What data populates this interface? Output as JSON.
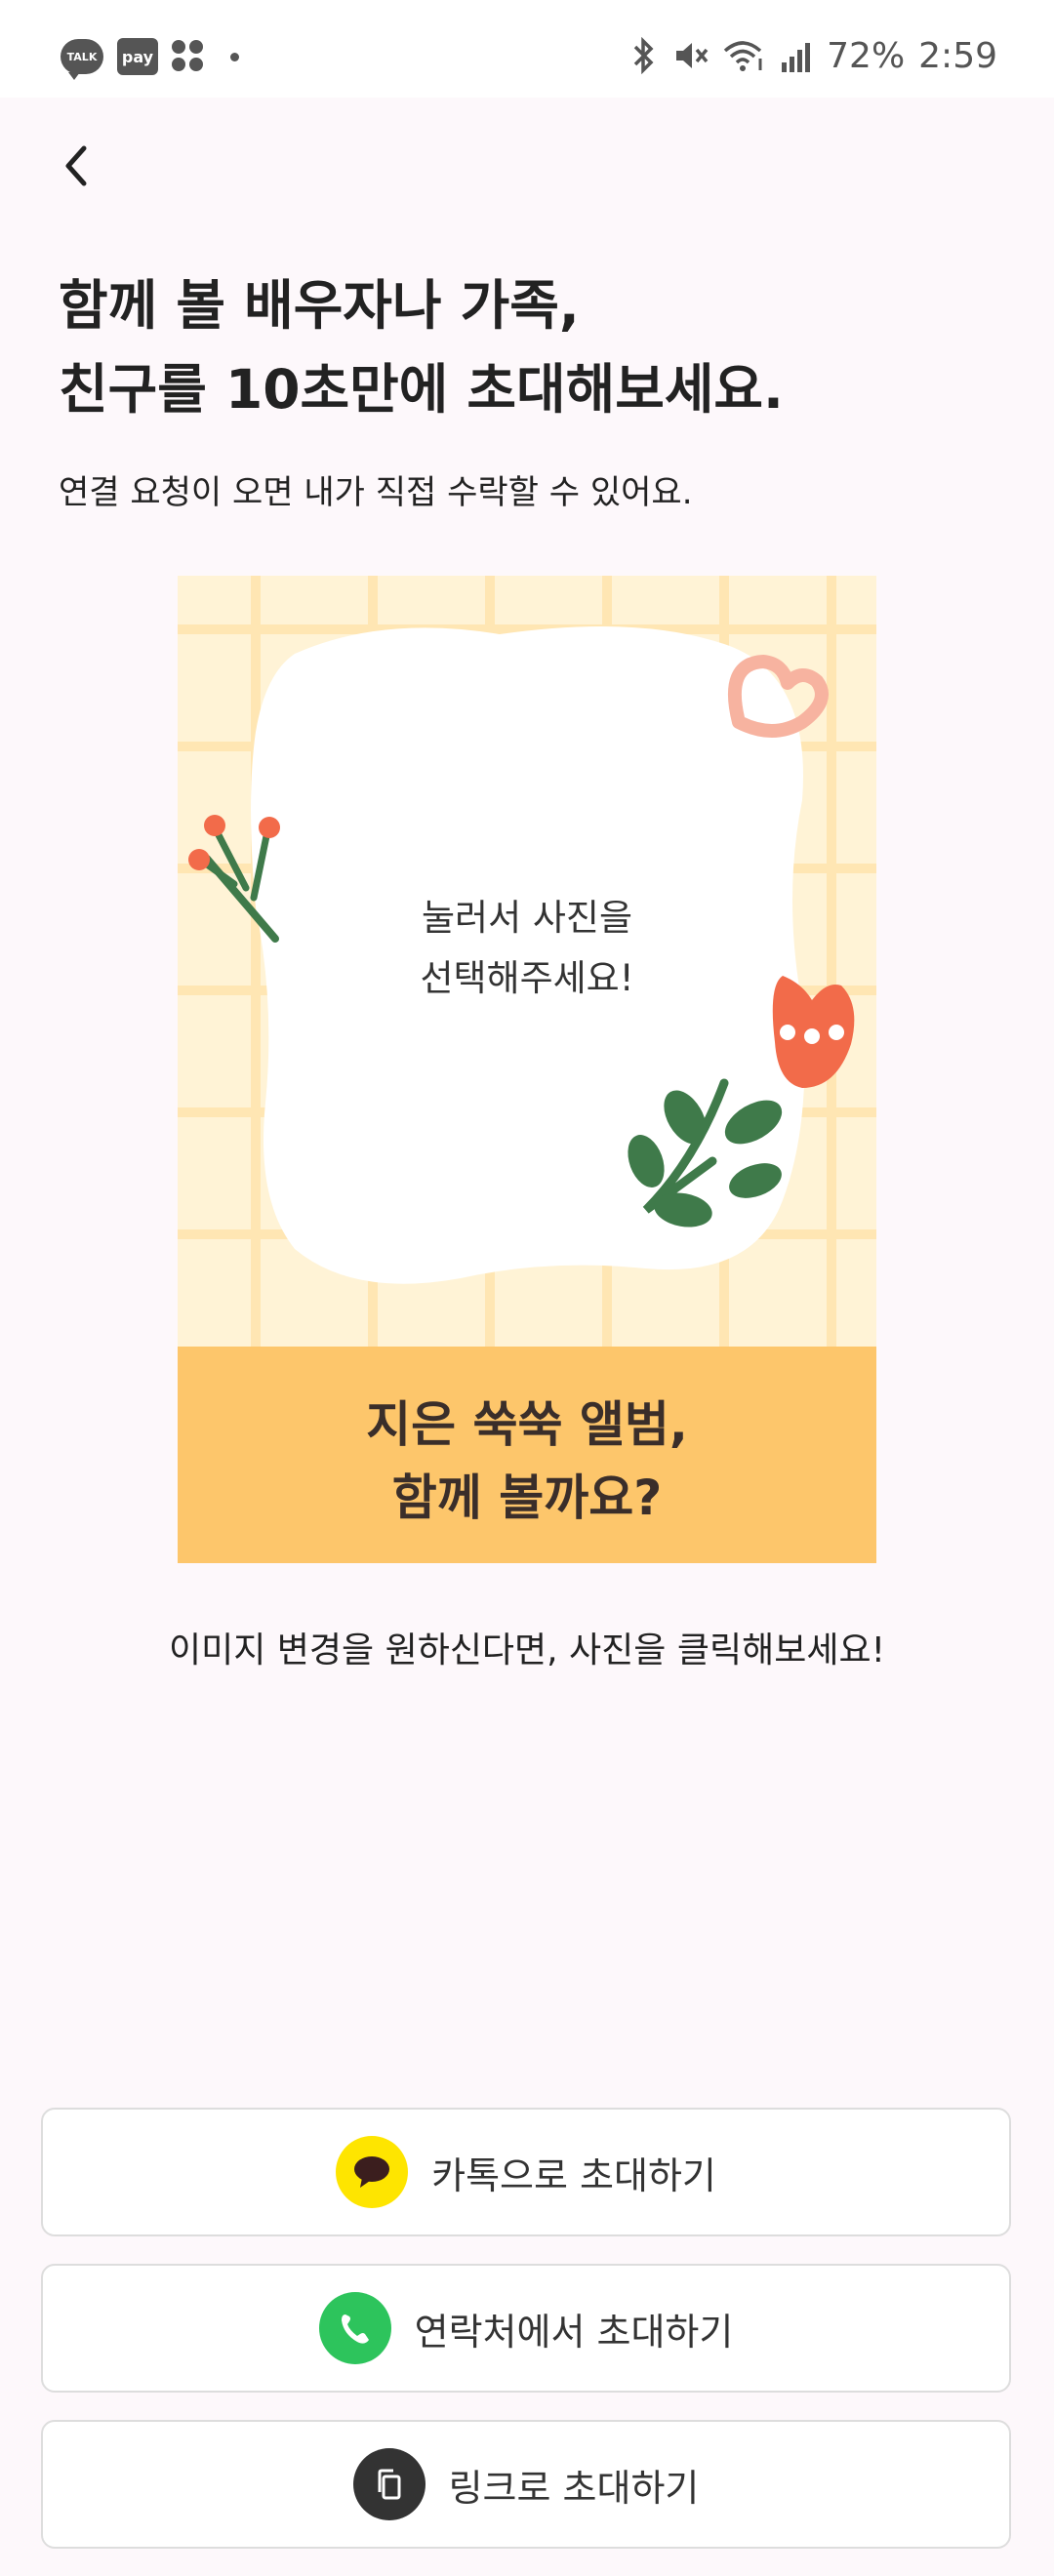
{
  "status_bar": {
    "talk_badge": "TALK",
    "pay_badge": "pay",
    "battery": "72%",
    "time": "2:59",
    "icons": [
      "bluetooth-icon",
      "mute-icon",
      "wifi-icon",
      "signal-icon"
    ]
  },
  "header": {
    "back_icon": "chevron-left-icon"
  },
  "headline": {
    "line1": "함께 볼 배우자나 가족,",
    "line2": "친구를 10초만에 초대해보세요."
  },
  "subline": "연결 요청이 오면 내가 직접 수락할 수 있어요.",
  "card": {
    "prompt_line1": "눌러서 사진을",
    "prompt_line2": "선택해주세요!",
    "footer_line1": "지은 쑥쑥 앨범,",
    "footer_line2": "함께 볼까요?",
    "colors": {
      "background": "#fff3d6",
      "grid": "#ffe6b3",
      "footer": "#fdc66b",
      "flower": "#f26b4a",
      "stem": "#3f7a4a",
      "heart": "#f7b3a0"
    }
  },
  "hint": "이미지 변경을 원하신다면, 사진을 클릭해보세요!",
  "buttons": {
    "kakao": {
      "label": "카톡으로 초대하기",
      "icon": "kakao-talk-icon",
      "color": "#fee500"
    },
    "contacts": {
      "label": "연락처에서 초대하기",
      "icon": "phone-icon",
      "color": "#2dc45c"
    },
    "link": {
      "label": "링크로 초대하기",
      "icon": "copy-link-icon",
      "color": "#333333"
    }
  }
}
